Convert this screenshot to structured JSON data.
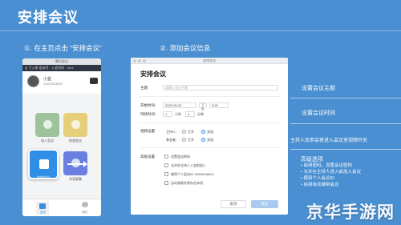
{
  "header": {
    "title": "安排会议"
  },
  "steps": {
    "step1": "①. 在主页点击 “安排会议”",
    "step2": "②. 添加会议信息"
  },
  "phone": {
    "statusbar": "腾讯会议",
    "topbar": "❮ 下入库  会议号 · 入会时间 · 34.6",
    "user_name": "小益",
    "user_phone": "13923448024",
    "tiles": {
      "join": "加入会议",
      "quick": "快速会议",
      "schedule": "安排会议",
      "share": "共享屏幕"
    },
    "tabs": {
      "home": "会议",
      "me": "我的"
    }
  },
  "dialog": {
    "window_title": "安排会议",
    "heading": "安排会议",
    "topic_label": "主题:",
    "topic_placeholder": "请输入会议主题",
    "start_label": "开始时间:",
    "start_date": "2020-05-20",
    "start_ampm": "下午",
    "start_time": "5:00",
    "duration_label": "持续时间:",
    "duration_hours": "1",
    "duration_unit": "小时",
    "duration_minutes": "0",
    "duration_min_unit": "分钟",
    "video_label": "视频设置:",
    "host_label": "主持人:",
    "participant_label": "参会者:",
    "on_text": "打开",
    "off_text": "关闭",
    "advanced_label": "高级设置:",
    "advanced_options": [
      "设置会议密码",
      "允许在主持人入会前加入",
      "使用个人会议ID 13923448024",
      "自动录制并保存在本机"
    ],
    "cancel_label": "取消",
    "ok_label": "预定"
  },
  "annotations": {
    "topic": "设置会议主题",
    "time": "设置会议时间",
    "video": "主持人及参会者进入会议室视频开关",
    "advanced_title": "高级选项",
    "advanced_items": [
      "• 启用密码，设置会议密码",
      "• 允许在主持人进入前加入会议",
      "• 使用个人会议ID",
      "• 启用自动录制会议"
    ]
  },
  "watermark": "京华手游网",
  "colors": {
    "background": "#4a8fd1",
    "accent": "#2f8fe6"
  }
}
